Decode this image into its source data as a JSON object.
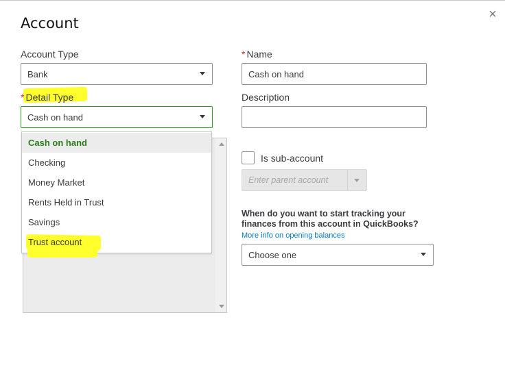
{
  "dialog": {
    "title": "Account",
    "close_glyph": "×"
  },
  "account_type": {
    "label": "Account Type",
    "value": "Bank"
  },
  "detail_type": {
    "required_mark": "*",
    "label": "Detail Type",
    "value": "Cash on hand"
  },
  "detail_type_options": [
    {
      "label": "Cash on hand",
      "selected": true
    },
    {
      "label": "Checking"
    },
    {
      "label": "Money Market"
    },
    {
      "label": "Rents Held in Trust"
    },
    {
      "label": "Savings"
    },
    {
      "label": "Trust account"
    }
  ],
  "name": {
    "required_mark": "*",
    "label": "Name",
    "value": "Cash on hand"
  },
  "description": {
    "label": "Description",
    "value": ""
  },
  "sub_account": {
    "label": "Is sub-account",
    "checked": false,
    "parent_placeholder": "Enter parent account"
  },
  "tracking": {
    "question": "When do you want to start tracking your finances from this account in QuickBooks?",
    "link": "More info on opening balances",
    "select_value": "Choose one"
  },
  "colors": {
    "required": "#d52b1e",
    "selected_text": "#2a7e19",
    "link": "#0077c5",
    "highlight": "#ffff2e",
    "focus_border": "#2ca01c"
  }
}
